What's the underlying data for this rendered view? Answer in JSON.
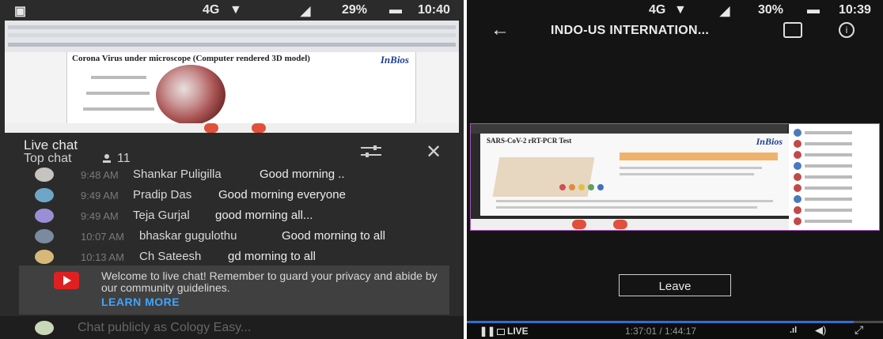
{
  "left": {
    "status": {
      "network": "4G",
      "battery": "29%",
      "time": "10:40"
    },
    "slide": {
      "title": "Corona Virus under microscope (Computer rendered 3D model)",
      "brand": "InBios"
    },
    "chat": {
      "title": "Live chat",
      "mode": "Top chat",
      "viewers": "11",
      "messages": [
        {
          "time": "9:48 AM",
          "name": "Shankar Puligilla",
          "text": "Good morning .."
        },
        {
          "time": "9:49 AM",
          "name": "Pradip Das",
          "text": "Good morning everyone"
        },
        {
          "time": "9:49 AM",
          "name": "Teja Gurjal",
          "text": "good morning all..."
        },
        {
          "time": "10:07 AM",
          "name": "bhaskar gugulothu",
          "text": "Good morning to all"
        },
        {
          "time": "10:13 AM",
          "name": "Ch Sateesh",
          "text": "gd morning to all"
        }
      ],
      "notice_text": "Welcome to live chat! Remember to guard your privacy and abide by our community guidelines.",
      "learn_more": "LEARN MORE",
      "input_placeholder": "Chat publicly as Cology Easy..."
    }
  },
  "right": {
    "status": {
      "network": "4G",
      "battery": "30%",
      "time": "10:39"
    },
    "title": "INDO-US INTERNATION...",
    "slide": {
      "title": "SARS-CoV-2 rRT-PCR Test",
      "brand": "InBios"
    },
    "leave_label": "Leave",
    "player": {
      "live_label": "LIVE",
      "timecode": "1:37:01 / 1:44:17",
      "progress": 0.93
    }
  },
  "colors": {
    "accent": "#3ea6ff",
    "youtube_red": "#e02020"
  },
  "icons": [
    "people-icon",
    "filter-icon",
    "close-icon",
    "youtube-icon",
    "back-arrow-icon",
    "chat-bubble-icon",
    "info-icon",
    "pause-icon",
    "volume-icon",
    "expand-icon"
  ]
}
